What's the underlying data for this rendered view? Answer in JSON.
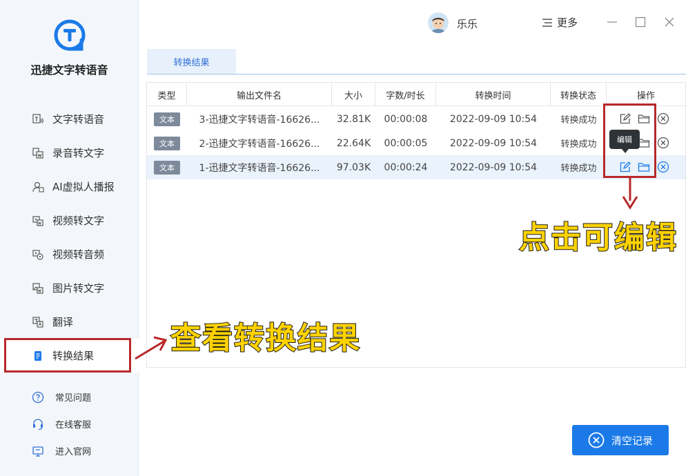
{
  "app": {
    "name": "迅捷文字转语音"
  },
  "sidebar": {
    "items": [
      {
        "label": "文字转语音",
        "icon": "text-to-speech-icon"
      },
      {
        "label": "录音转文字",
        "icon": "recording-to-text-icon"
      },
      {
        "label": "AI虚拟人播报",
        "icon": "ai-avatar-icon"
      },
      {
        "label": "视频转文字",
        "icon": "video-to-text-icon"
      },
      {
        "label": "视频转音频",
        "icon": "video-to-audio-icon"
      },
      {
        "label": "图片转文字",
        "icon": "image-to-text-icon"
      },
      {
        "label": "翻译",
        "icon": "translate-icon"
      },
      {
        "label": "转换结果",
        "icon": "results-icon",
        "active": true
      }
    ],
    "bottom": [
      {
        "label": "常见问题",
        "icon": "help-icon"
      },
      {
        "label": "在线客服",
        "icon": "headset-icon"
      },
      {
        "label": "进入官网",
        "icon": "monitor-icon"
      }
    ]
  },
  "header": {
    "username": "乐乐",
    "more_label": "更多"
  },
  "tab": {
    "label": "转换结果"
  },
  "table": {
    "columns": [
      "类型",
      "输出文件名",
      "大小",
      "字数/时长",
      "转换时间",
      "转换状态",
      "操作"
    ],
    "rows": [
      {
        "type": "文本",
        "filename": "3-迅捷文字转语音-16626...",
        "size": "32.81K",
        "duration": "00:00:08",
        "time": "2022-09-09 10:54",
        "status": "转换成功"
      },
      {
        "type": "文本",
        "filename": "2-迅捷文字转语音-16626...",
        "size": "22.64K",
        "duration": "00:00:05",
        "time": "2022-09-09 10:54",
        "status": "转换成功"
      },
      {
        "type": "文本",
        "filename": "1-迅捷文字转语音-16626...",
        "size": "97.03K",
        "duration": "00:00:24",
        "time": "2022-09-09 10:54",
        "status": "转换成功"
      }
    ]
  },
  "tooltip": {
    "label": "编辑"
  },
  "annotations": {
    "edit_hint": "点击可编辑",
    "results_hint": "查看转换结果",
    "color": "#b8282a"
  },
  "clear_button": {
    "label": "清空记录"
  },
  "colors": {
    "accent": "#1b7ae8",
    "sidebar_bg": "#f3f7fb",
    "annotation_text": "#ffd200"
  }
}
